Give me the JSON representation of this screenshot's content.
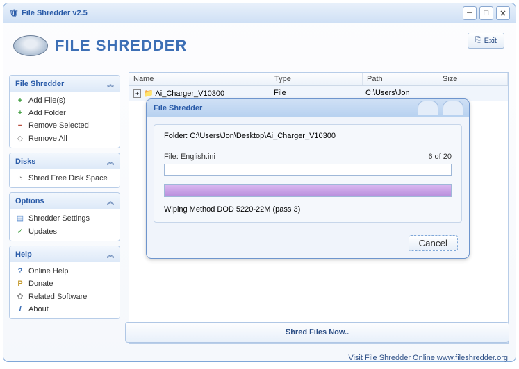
{
  "window": {
    "title": "File Shredder v2.5"
  },
  "header": {
    "logo": "FILE SHREDDER",
    "exit": "Exit"
  },
  "sidebar": {
    "panels": [
      {
        "title": "File Shredder",
        "items": [
          {
            "icon": "+",
            "color": "#3a9a3a",
            "label": "Add File(s)"
          },
          {
            "icon": "+",
            "color": "#3a9a3a",
            "label": "Add Folder"
          },
          {
            "icon": "−",
            "color": "#b64a3a",
            "label": "Remove Selected"
          },
          {
            "icon": "◇",
            "color": "#888",
            "label": "Remove All"
          }
        ]
      },
      {
        "title": "Disks",
        "items": [
          {
            "icon": "◔",
            "color": "#888",
            "label": "Shred Free Disk Space"
          }
        ]
      },
      {
        "title": "Options",
        "items": [
          {
            "icon": "📄",
            "color": "#5b8ed0",
            "label": "Shredder Settings"
          },
          {
            "icon": "✓",
            "color": "#3a9a3a",
            "label": "Updates"
          }
        ]
      },
      {
        "title": "Help",
        "items": [
          {
            "icon": "?",
            "color": "#3d6fb5",
            "label": "Online Help"
          },
          {
            "icon": "P",
            "color": "#c59a2d",
            "label": "Donate"
          },
          {
            "icon": "🔗",
            "color": "#888",
            "label": "Related Software"
          },
          {
            "icon": "i",
            "color": "#3d6fb5",
            "label": "About"
          }
        ]
      }
    ]
  },
  "listview": {
    "columns": {
      "name": "Name",
      "type": "Type",
      "path": "Path",
      "size": "Size"
    },
    "row": {
      "name": "Ai_Charger_V10300",
      "type": "File",
      "path": "C:\\Users\\Jon",
      "size": ""
    }
  },
  "dialog": {
    "title": "File Shredder",
    "folder": "Folder: C:\\Users\\Jon\\Desktop\\Ai_Charger_V10300",
    "file": "File: English.ini",
    "count": "6  of  20",
    "method": "Wiping Method DOD 5220-22M  (pass 3)",
    "cancel": "Cancel"
  },
  "shred_button": "Shred Files Now..",
  "status": "Visit File Shredder Online   www.fileshredder.org"
}
